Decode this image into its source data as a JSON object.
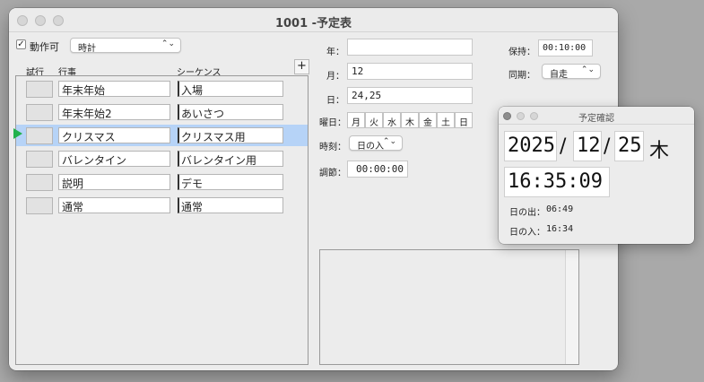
{
  "window": {
    "title": "1001 -予定表"
  },
  "toolbar": {
    "enabled_label": "動作可",
    "enabled_checked": true,
    "mode_select": "時計"
  },
  "columns": {
    "trial": "試行",
    "event": "行事",
    "sequence": "シーケンス",
    "add": "+"
  },
  "rows": [
    {
      "event": "年末年始",
      "sequence": "入場",
      "selected": false
    },
    {
      "event": "年末年始2",
      "sequence": "あいさつ",
      "selected": false
    },
    {
      "event": "クリスマス",
      "sequence": "クリスマス用",
      "selected": true
    },
    {
      "event": "バレンタイン",
      "sequence": "バレンタイン用",
      "selected": false
    },
    {
      "event": "説明",
      "sequence": "デモ",
      "selected": false
    },
    {
      "event": "通常",
      "sequence": "通常",
      "selected": false
    }
  ],
  "form": {
    "year_label": "年：",
    "year_value": "",
    "month_label": "月：",
    "month_value": "12",
    "day_label": "日：",
    "day_value": "24,25",
    "weekday_label": "曜日：",
    "weekdays": [
      "月",
      "火",
      "水",
      "木",
      "金",
      "土",
      "日"
    ],
    "time_label": "時刻：",
    "time_select": "日の入",
    "adjust_label": "調節：",
    "adjust_value": "00:00:00",
    "hold_label": "保持：",
    "hold_value": "00:10:00",
    "sync_label": "同期：",
    "sync_select": "自走"
  },
  "clock": {
    "title": "予定確認",
    "year": "2025",
    "month": "12",
    "day": "25",
    "weekday": "木",
    "sep": "/",
    "time": "16:35:09",
    "sunrise_label": "日の出：",
    "sunrise": "06:49",
    "sunset_label": "日の入：",
    "sunset": "16:34"
  },
  "icons": {
    "checkbox": "check-icon",
    "popup": "updown-chevron-icon",
    "row_marker": "play-triangle-icon"
  },
  "colors": {
    "selection": "#b6d3f7",
    "marker": "#22b14c"
  }
}
